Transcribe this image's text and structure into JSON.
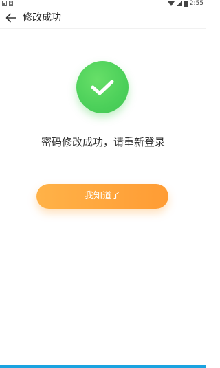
{
  "status_bar": {
    "time": "2:55",
    "icons_left": [
      "sim-card-icon",
      "download-icon"
    ],
    "icons_right": [
      "wifi-icon",
      "signal-icon",
      "battery-icon"
    ]
  },
  "app_bar": {
    "title": "修改成功",
    "back_icon": "arrow-left-icon"
  },
  "content": {
    "success_icon": "check-circle-icon",
    "success_color": "#4cd05a",
    "message": "密码修改成功，请重新登录",
    "button_label": "我知道了",
    "button_color": "#ff9c34"
  },
  "theme": {
    "bottom_bar_color": "#1aa3e0"
  }
}
